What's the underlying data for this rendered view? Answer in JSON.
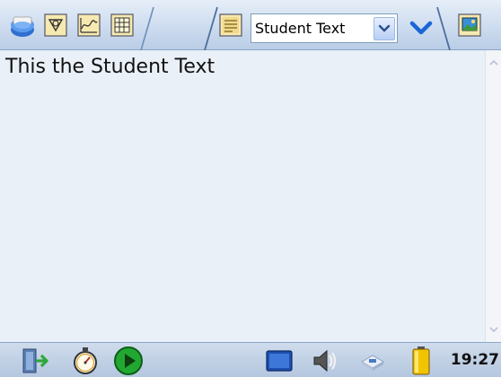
{
  "toolbar": {
    "icons": [
      "folder-icon",
      "tools-icon",
      "graph-icon",
      "table-icon",
      "text-icon",
      "chevron-down-icon",
      "image-icon"
    ],
    "page_select": {
      "value": "Student Text"
    }
  },
  "content": {
    "text": "This the Student Text"
  },
  "taskbar": {
    "icons": [
      "exit-icon",
      "stopwatch-icon",
      "play-icon",
      "screen-icon",
      "speaker-icon",
      "network-icon",
      "battery-icon"
    ],
    "time": "19:27"
  },
  "colors": {
    "accent": "#1a66d6",
    "content_bg": "#eaf0f8",
    "toolbar_bg": "#cddcef",
    "play_green": "#22a832"
  }
}
